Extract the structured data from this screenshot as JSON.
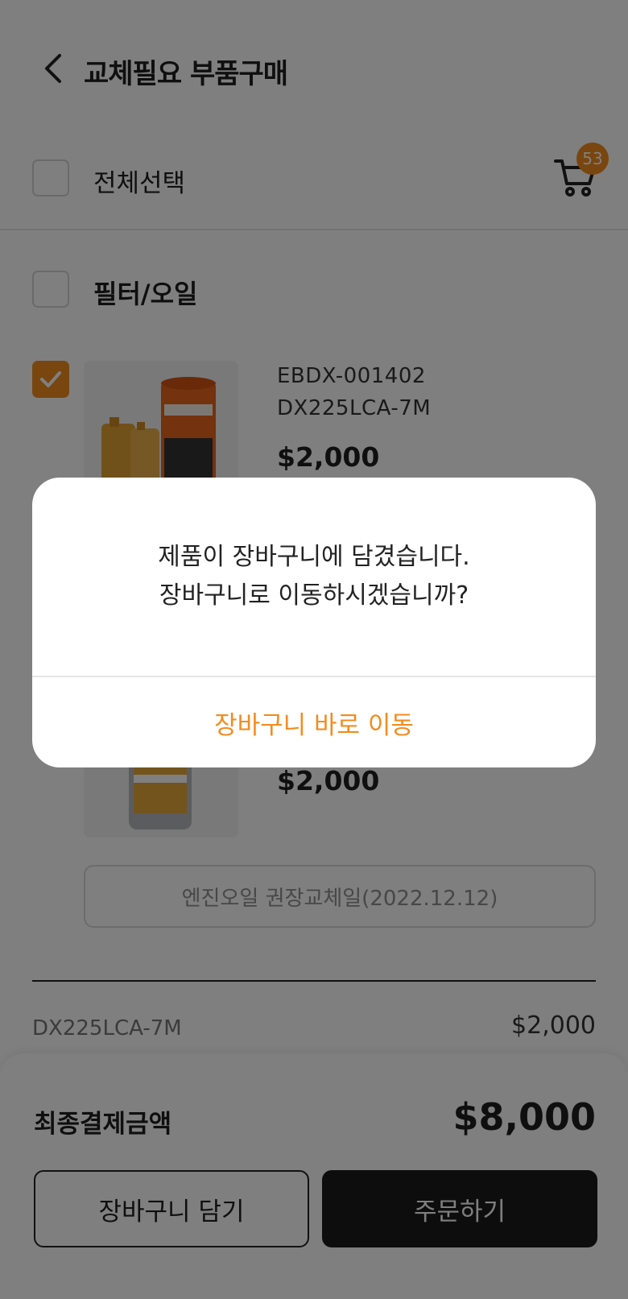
{
  "header": {
    "title": "교체필요 부품구매"
  },
  "select_all": {
    "label": "전체선택"
  },
  "cart": {
    "badge": "53"
  },
  "section": {
    "title": "필터/오일"
  },
  "products": [
    {
      "code": "EBDX-001402",
      "model": "DX225LCA-7M",
      "price": "$2,000",
      "checked": true
    },
    {
      "price": "$2,000"
    }
  ],
  "recommendation": {
    "text": "엔진오일 권장교체일(2022.12.12)"
  },
  "summary": {
    "model": "DX225LCA-7M",
    "price": "$2,000"
  },
  "footer": {
    "total_label": "최종결제금액",
    "total_value": "$8,000",
    "add_to_cart": "장바구니 담기",
    "order": "주문하기"
  },
  "dialog": {
    "message_line1": "제품이 장바구니에 담겼습니다.",
    "message_line2": "장바구니로 이동하시겠습니까?",
    "action": "장바구니 바로 이동"
  },
  "colors": {
    "accent": "#f28c1f",
    "dark": "#1a1a1a"
  }
}
